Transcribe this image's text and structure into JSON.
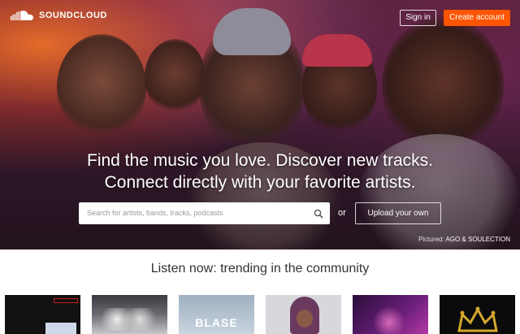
{
  "brand": {
    "name": "SOUNDCLOUD",
    "logo_icon": "soundcloud-cloud-icon"
  },
  "header": {
    "signin_label": "Sign in",
    "create_label": "Create account"
  },
  "hero": {
    "headline_line1": "Find the music you love. Discover new tracks.",
    "headline_line2": "Connect directly with your favorite artists.",
    "search_placeholder": "Search for artists, bands, tracks, podcasts",
    "or_label": "or",
    "upload_label": "Upload your own",
    "credit_prefix": "Pictured:",
    "credit_names": "AGO & SOULECTION"
  },
  "trending": {
    "title": "Listen now: trending in the community",
    "tile_texts": [
      "",
      "",
      "BLASE",
      "",
      "",
      ""
    ]
  },
  "colors": {
    "accent": "#ff5500"
  }
}
